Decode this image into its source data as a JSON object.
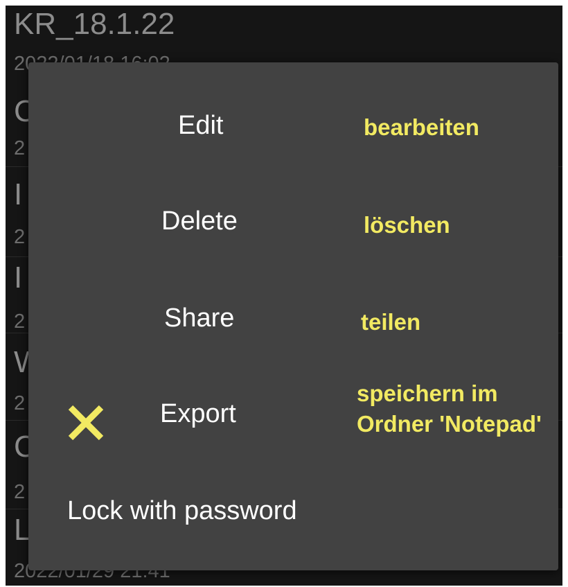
{
  "background_notes": [
    {
      "title": "KR_18.1.22",
      "date": "2022/01/18 16:02"
    },
    {
      "title": "C",
      "date": "2"
    },
    {
      "title": "I",
      "date": "2"
    },
    {
      "title": "I",
      "date": "2"
    },
    {
      "title": "W",
      "date": "2"
    },
    {
      "title": "C",
      "date": "2"
    },
    {
      "title": "L",
      "date": "2022/01/29 21:41"
    }
  ],
  "menu": {
    "items": [
      {
        "label": "Edit",
        "annotation": "bearbeiten"
      },
      {
        "label": "Delete",
        "annotation": "löschen"
      },
      {
        "label": "Share",
        "annotation": "teilen"
      },
      {
        "label": "Export",
        "annotation_line1": "speichern im",
        "annotation_line2": "Ordner 'Notepad'"
      },
      {
        "label": "Lock with password"
      }
    ]
  },
  "colors": {
    "dialog_bg": "#424242",
    "annotation": "#f2ea62",
    "background": "#151515"
  },
  "icons": {
    "export_marker": "x-mark-icon"
  }
}
